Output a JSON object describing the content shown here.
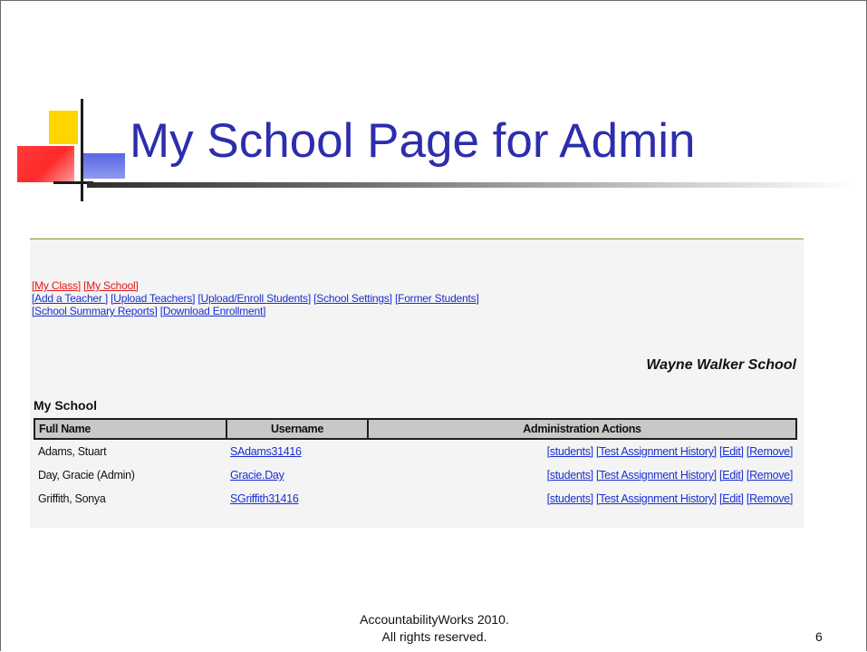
{
  "title": "My School Page for Admin",
  "nav": {
    "row1": [
      "[My Class]",
      "[My School]"
    ],
    "row2": [
      "[Add a Teacher ]",
      "[Upload Teachers]",
      "[Upload/Enroll Students]",
      "[School Settings]",
      "[Former Students]"
    ],
    "row3": [
      "[School Summary Reports]",
      "[Download Enrollment]"
    ]
  },
  "school_name": "Wayne Walker School",
  "section_title": "My School",
  "table": {
    "headers": [
      "Full Name",
      "Username",
      "Administration Actions"
    ],
    "rows": [
      {
        "full_name": "Adams, Stuart",
        "username": "SAdams31416"
      },
      {
        "full_name": "Day, Gracie (Admin)",
        "username": "Gracie.Day"
      },
      {
        "full_name": "Griffith, Sonya",
        "username": "SGriffith31416"
      }
    ],
    "actions": [
      "[students]",
      "[Test Assignment History]",
      "[Edit]",
      "[Remove]"
    ]
  },
  "footer": {
    "line1": "AccountabilityWorks 2010.",
    "line2": "All rights reserved."
  },
  "page_number": "6",
  "colors": {
    "title": "#2d2dad",
    "link": "#1a2fd1",
    "active_link": "#e01a1a",
    "header_bg": "#c8c8c8"
  }
}
